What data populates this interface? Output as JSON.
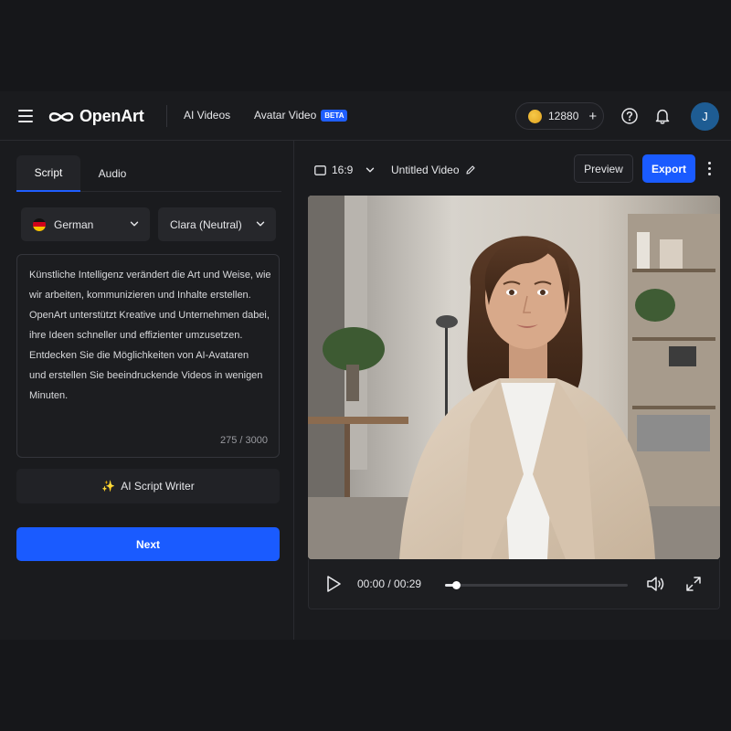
{
  "header": {
    "logo_text": "OpenArt",
    "nav": [
      {
        "label": "AI Videos"
      },
      {
        "label": "Avatar Video",
        "badge": "BETA"
      }
    ],
    "credits": "12880",
    "credits_add": "+",
    "avatar_initial": "J",
    "icons": [
      "menu-icon",
      "help-icon",
      "bell-icon"
    ]
  },
  "left": {
    "tabs": [
      "Script",
      "Audio"
    ],
    "active_tab": "Script",
    "language": "German",
    "voice": "Clara (Neutral)",
    "script_lines": [
      "Künstliche Intelligenz verändert die Art und Weise, wie",
      "wir arbeiten, kommunizieren und Inhalte erstellen.",
      "OpenArt unterstützt Kreative und Unternehmen dabei,",
      "ihre Ideen schneller und effizienter umzusetzen.",
      "Entdecken Sie die Möglichkeiten von AI-Avataren",
      "und erstellen Sie beeindruckende Videos in wenigen",
      "Minuten."
    ],
    "char_count": "275 / 3000",
    "ai_writer_icon": "✨",
    "ai_writer_label": "AI Script Writer",
    "next_label": "Next"
  },
  "right": {
    "aspect_ratio": "16:9",
    "video_title": "Untitled Video",
    "preview_label": "Preview",
    "export_label": "Export",
    "player": {
      "time": "00:00 / 00:29",
      "progress": 0.06
    }
  },
  "colors": {
    "accent": "#1a5bff",
    "background": "#1a1b1e",
    "avatar_bg": "#1e5c93"
  }
}
